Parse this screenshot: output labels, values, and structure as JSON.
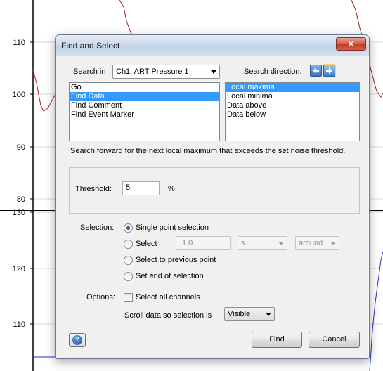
{
  "background_chart": {
    "upper_axis_ticks": [
      "110",
      "100",
      "90",
      "80"
    ],
    "lower_axis_ticks": [
      "130",
      "120",
      "110"
    ],
    "colors": {
      "trace_upper": "#b01818",
      "trace_lower": "#1a2fd0",
      "grid": "#dadada"
    }
  },
  "dialog": {
    "title": "Find and Select",
    "close_icon": "close-icon",
    "search_in_label": "Search in",
    "search_in_value": "Ch1: ART Pressure 1",
    "search_direction_label": "Search direction:",
    "direction_icons": [
      "arrow-left-icon",
      "arrow-right-icon"
    ],
    "find_types": [
      "Go",
      "Find Data",
      "Find Comment",
      "Find Event Marker"
    ],
    "find_type_selected": "Find Data",
    "data_criteria": [
      "Local maxima",
      "Local minima",
      "Data above",
      "Data below"
    ],
    "data_criteria_selected": "Local maxima",
    "description": "Search forward for the next local maximum that exceeds the set noise threshold.",
    "threshold_label": "Threshold:",
    "threshold_value": "5",
    "threshold_unit": "%",
    "selection_label": "Selection:",
    "selection_options": {
      "single": "Single point selection",
      "select": "Select",
      "to_previous": "Select to previous point",
      "set_end": "Set end of selection"
    },
    "selection_checked": "Single point selection",
    "select_amount": "1.0",
    "select_unit": "s",
    "select_position": "around",
    "options_label": "Options:",
    "select_all_channels": "Select all channels",
    "select_all_channels_checked": false,
    "scroll_label": "Scroll data so selection is",
    "scroll_value": "Visible",
    "find_button": "Find",
    "cancel_button": "Cancel",
    "help_icon": "help-icon",
    "colors": {
      "selection": "#3399ff",
      "close_button": "#c9452c"
    }
  }
}
